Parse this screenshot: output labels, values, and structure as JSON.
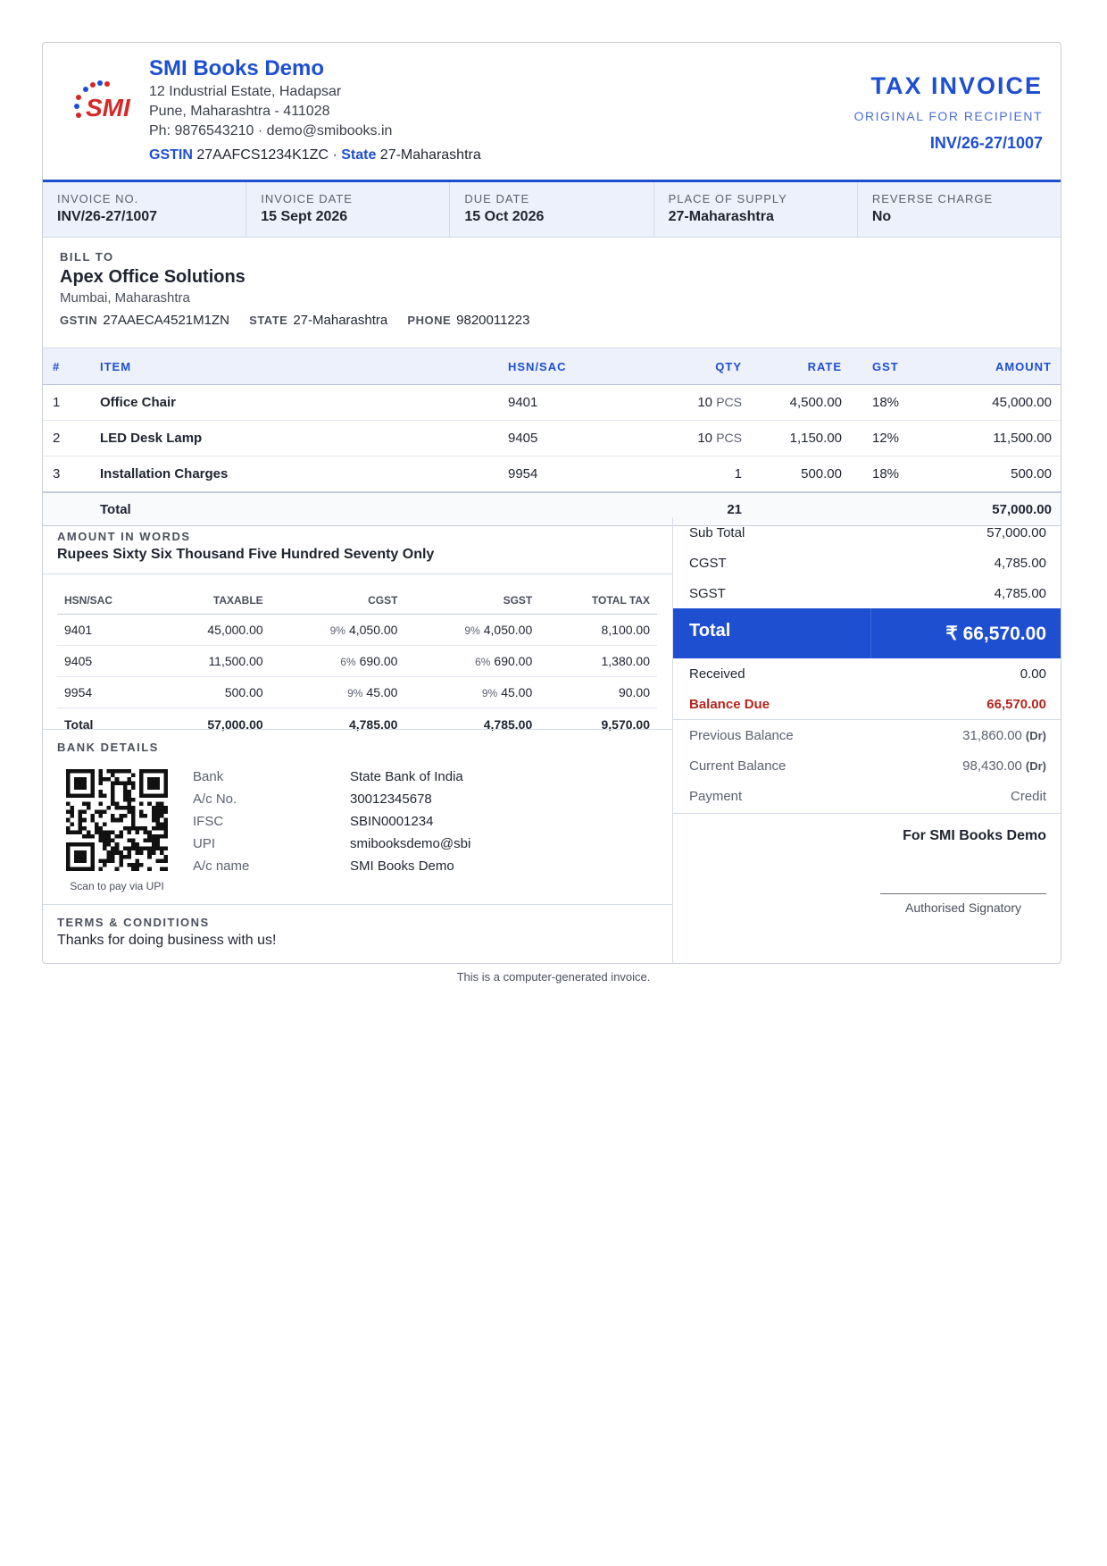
{
  "company": {
    "name": "SMI Books Demo",
    "address1": "12 Industrial Estate, Hadapsar",
    "address2": "Pune, Maharashtra - 411028",
    "contact": "Ph: 9876543210 · demo@smibooks.in",
    "gstin_label": "GSTIN",
    "gstin": "27AAFCS1234K1ZC",
    "sep": "·",
    "state_label": "State",
    "state": "27-Maharashtra",
    "logo_text": "SMI"
  },
  "document": {
    "title": "TAX INVOICE",
    "subtitle": "ORIGINAL FOR RECIPIENT",
    "number": "INV/26-27/1007"
  },
  "meta": [
    {
      "label": "INVOICE NO.",
      "value": "INV/26-27/1007"
    },
    {
      "label": "INVOICE DATE",
      "value": "15 Sept 2026"
    },
    {
      "label": "DUE DATE",
      "value": "15 Oct 2026"
    },
    {
      "label": "PLACE OF SUPPLY",
      "value": "27-Maharashtra"
    },
    {
      "label": "REVERSE CHARGE",
      "value": "No"
    }
  ],
  "bill_to": {
    "heading": "BILL TO",
    "name": "Apex Office Solutions",
    "address": "Mumbai, Maharashtra",
    "gstin_label": "GSTIN",
    "gstin": "27AAECA4521M1ZN",
    "state_label": "STATE",
    "state": "27-Maharashtra",
    "phone_label": "PHONE",
    "phone": "9820011223"
  },
  "items_table": {
    "headers": {
      "n": "#",
      "item": "ITEM",
      "hsn": "HSN/SAC",
      "qty": "QTY",
      "rate": "RATE",
      "gst": "GST",
      "amount": "AMOUNT"
    },
    "rows": [
      {
        "n": "1",
        "item": "Office Chair",
        "hsn": "9401",
        "qty": "10",
        "unit": "PCS",
        "rate": "4,500.00",
        "gst": "18%",
        "amount": "45,000.00"
      },
      {
        "n": "2",
        "item": "LED Desk Lamp",
        "hsn": "9405",
        "qty": "10",
        "unit": "PCS",
        "rate": "1,150.00",
        "gst": "12%",
        "amount": "11,500.00"
      },
      {
        "n": "3",
        "item": "Installation Charges",
        "hsn": "9954",
        "qty": "1",
        "unit": "",
        "rate": "500.00",
        "gst": "18%",
        "amount": "500.00"
      }
    ],
    "total_label": "Total",
    "total_qty": "21",
    "total_amount": "57,000.00"
  },
  "amount_in_words": {
    "label": "AMOUNT IN WORDS",
    "value": "Rupees Sixty Six Thousand Five Hundred Seventy Only"
  },
  "tax_summary": {
    "headers": {
      "hsn": "HSN/SAC",
      "taxable": "TAXABLE",
      "cgst": "CGST",
      "sgst": "SGST",
      "total_tax": "TOTAL TAX"
    },
    "rows": [
      {
        "hsn": "9401",
        "taxable": "45,000.00",
        "cgst_rate": "9%",
        "cgst": "4,050.00",
        "sgst_rate": "9%",
        "sgst": "4,050.00",
        "total_tax": "8,100.00"
      },
      {
        "hsn": "9405",
        "taxable": "11,500.00",
        "cgst_rate": "6%",
        "cgst": "690.00",
        "sgst_rate": "6%",
        "sgst": "690.00",
        "total_tax": "1,380.00"
      },
      {
        "hsn": "9954",
        "taxable": "500.00",
        "cgst_rate": "9%",
        "cgst": "45.00",
        "sgst_rate": "9%",
        "sgst": "45.00",
        "total_tax": "90.00"
      }
    ],
    "total": {
      "label": "Total",
      "taxable": "57,000.00",
      "cgst": "4,785.00",
      "sgst": "4,785.00",
      "total_tax": "9,570.00"
    }
  },
  "bank": {
    "heading": "BANK DETAILS",
    "qr_caption": "Scan to pay via UPI",
    "rows": [
      {
        "label": "Bank",
        "value": "State Bank of India"
      },
      {
        "label": "A/c No.",
        "value": "30012345678"
      },
      {
        "label": "IFSC",
        "value": "SBIN0001234"
      },
      {
        "label": "UPI",
        "value": "smibooksdemo@sbi"
      },
      {
        "label": "A/c name",
        "value": "SMI Books Demo"
      }
    ]
  },
  "terms": {
    "heading": "TERMS & CONDITIONS",
    "text": "Thanks for doing business with us!"
  },
  "summary": {
    "sub_total_label": "Sub Total",
    "sub_total": "57,000.00",
    "cgst_label": "CGST",
    "cgst": "4,785.00",
    "sgst_label": "SGST",
    "sgst": "4,785.00",
    "total_label": "Total",
    "total": "₹ 66,570.00",
    "received_label": "Received",
    "received": "0.00",
    "balance_due_label": "Balance Due",
    "balance_due": "66,570.00",
    "previous_balance_label": "Previous Balance",
    "previous_balance": "31,860.00",
    "previous_balance_type": "(Dr)",
    "current_balance_label": "Current Balance",
    "current_balance": "98,430.00",
    "current_balance_type": "(Dr)",
    "payment_label": "Payment",
    "payment": "Credit"
  },
  "signature": {
    "for_company": "For SMI Books Demo",
    "caption": "Authorised Signatory"
  },
  "footer": "This is a computer-generated invoice.",
  "colors": {
    "accent": "#1f4fd1",
    "due": "#b3261e",
    "logo_red": "#d62828"
  }
}
